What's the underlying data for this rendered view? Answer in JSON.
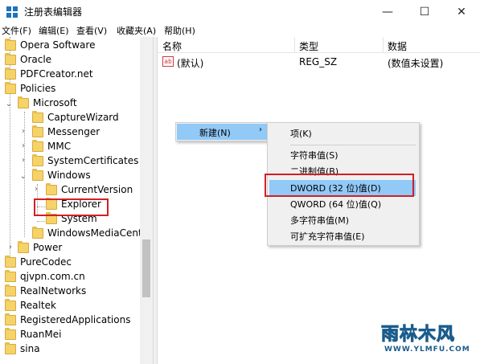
{
  "window": {
    "title": "注册表编辑器",
    "controls": {
      "minimize": "—",
      "maximize": "☐",
      "close": "✕"
    }
  },
  "menubar": [
    "文件(F)",
    "编辑(E)",
    "查看(V)",
    "收藏夹(A)",
    "帮助(H)"
  ],
  "tree": {
    "items": [
      {
        "label": "Opera Software"
      },
      {
        "label": "Oracle"
      },
      {
        "label": "PDFCreator.net"
      },
      {
        "label": "Policies"
      },
      {
        "label": "Microsoft"
      },
      {
        "label": "CaptureWizard"
      },
      {
        "label": "Messenger"
      },
      {
        "label": "MMC"
      },
      {
        "label": "SystemCertificates"
      },
      {
        "label": "Windows"
      },
      {
        "label": "CurrentVersion"
      },
      {
        "label": "Explorer"
      },
      {
        "label": "System"
      },
      {
        "label": "WindowsMediaCenter"
      },
      {
        "label": "Power"
      },
      {
        "label": "PureCodec"
      },
      {
        "label": "qjvpn.com.cn"
      },
      {
        "label": "RealNetworks"
      },
      {
        "label": "Realtek"
      },
      {
        "label": "RegisteredApplications"
      },
      {
        "label": "RuanMei"
      },
      {
        "label": "sina"
      }
    ]
  },
  "list": {
    "columns": [
      "名称",
      "类型",
      "数据"
    ],
    "rows": [
      {
        "name": "(默认)",
        "type": "REG_SZ",
        "data": "(数值未设置)",
        "icon": "ab"
      }
    ]
  },
  "context_menu": {
    "new_label": "新建(N)",
    "arrow": "›",
    "submenu": [
      "项(K)",
      "字符串值(S)",
      "二进制值(B)",
      "DWORD (32 位)值(D)",
      "QWORD (64 位)值(Q)",
      "多字符串值(M)",
      "可扩充字符串值(E)"
    ],
    "highlighted": "DWORD (32 位)值(D)"
  },
  "watermark": {
    "title": "雨林木风",
    "url": "WWW.YLMFU.COM"
  },
  "colors": {
    "highlight": "#91c9f7",
    "annotation_red": "#d21f26",
    "folder": "#f6d26a"
  }
}
